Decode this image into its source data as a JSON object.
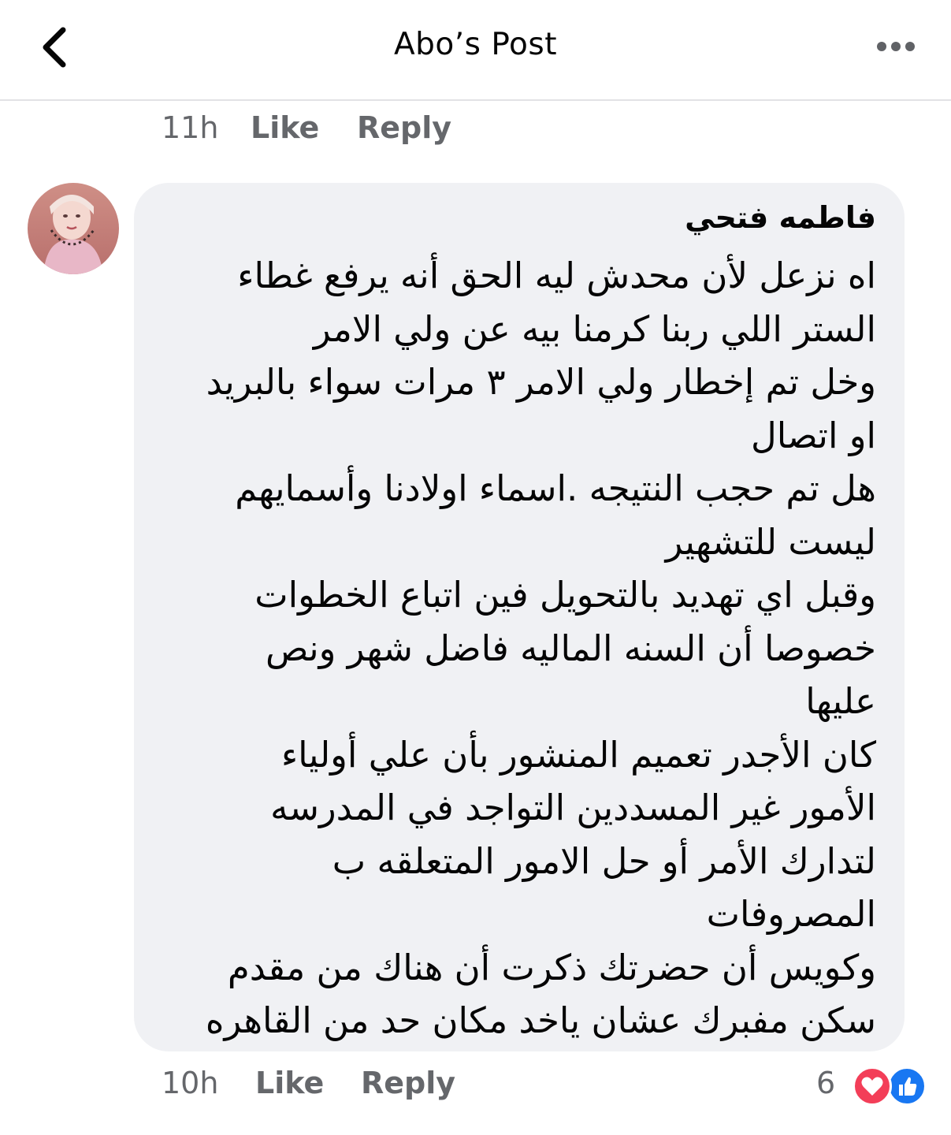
{
  "header": {
    "title": "Abo’s Post",
    "back_icon": "chevron-left-icon",
    "more_icon": "more-horizontal-icon"
  },
  "previous_comment": {
    "time": "11h",
    "like_label": "Like",
    "reply_label": "Reply"
  },
  "comment": {
    "author": "فاطمه  فتحي",
    "lines": [
      "اه نزعل لأن محدش ليه الحق أنه يرفع غطاء",
      "الستر اللي ربنا كرمنا بيه عن ولي الامر",
      "وخل تم إخطار ولي الامر ٣ مرات سواء بالبريد",
      "او اتصال",
      "هل تم حجب النتيجه .اسماء اولادنا وأسمايهم",
      "ليست للتشهير",
      "وقبل اي تهديد بالتحويل فين اتباع الخطوات",
      "خصوصا أن السنه الماليه فاضل شهر ونص",
      "عليها",
      "كان الأجدر تعميم المنشور بأن علي أولياء",
      "الأمور غير المسددين التواجد في المدرسه",
      "لتدارك الأمر أو حل الامور المتعلقه ب",
      "المصروفات",
      "وكويس أن حضرتك ذكرت أن هناك من مقدم",
      "سكن مفبرك عشان ياخد مكان حد من القاهره"
    ],
    "time": "10h",
    "like_label": "Like",
    "reply_label": "Reply",
    "reaction_count": "6",
    "reaction_icons": [
      "love-reaction-icon",
      "like-reaction-icon"
    ],
    "colors": {
      "love": "#f33e58",
      "like": "#1877f2"
    }
  }
}
